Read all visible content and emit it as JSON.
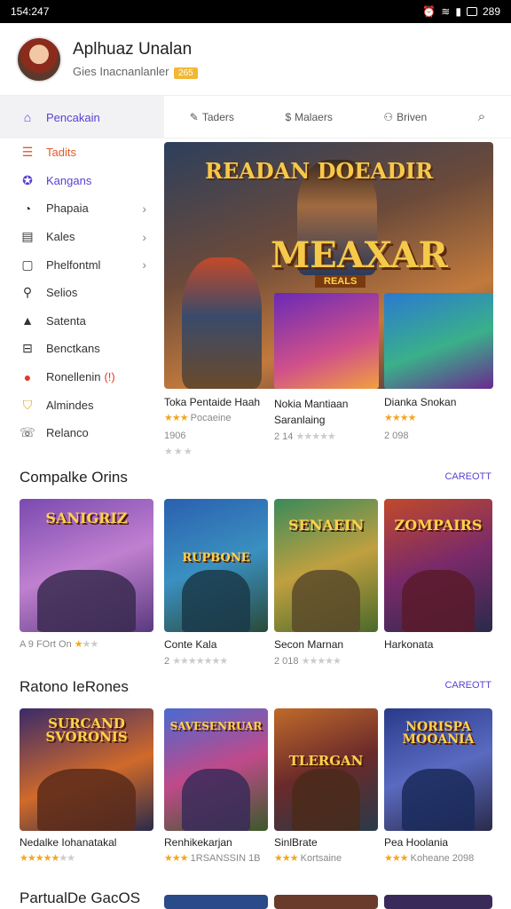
{
  "status": {
    "time": "154:247",
    "battery": "289"
  },
  "header": {
    "title": "Aplhuaz Unalan",
    "subtitle": "Gies Inacnanlanler",
    "badge": "265"
  },
  "sidebar": {
    "items": [
      {
        "label": "Pencakain",
        "icon": "home-icon"
      },
      {
        "label": "Tadits",
        "icon": "list-icon"
      },
      {
        "label": "Kangans",
        "icon": "gamepad-icon"
      },
      {
        "label": "Phapaia",
        "icon": "clock-icon"
      },
      {
        "label": "Kales",
        "icon": "document-icon"
      },
      {
        "label": "Phelfontml",
        "icon": "square-icon"
      },
      {
        "label": "Selios",
        "icon": "wrench-icon"
      },
      {
        "label": "Satenta",
        "icon": "person-icon"
      },
      {
        "label": "Benctkans",
        "icon": "chart-icon"
      },
      {
        "label": "Ronellenin",
        "icon": "record-icon"
      },
      {
        "label": "Almindes",
        "icon": "shield-icon"
      },
      {
        "label": "Relanco",
        "icon": "phone-icon"
      }
    ]
  },
  "topnav": {
    "tab1": "Taders",
    "tab2": "Malaers",
    "tab3": "Briven"
  },
  "hero": {
    "title_top": "READAN DOEADIR",
    "title_main": "MEAXAR",
    "ribbon": "REALS"
  },
  "featured": [
    {
      "title": "Toka Pentaide Haah",
      "meta1": "Pocaeine",
      "meta2": "1906"
    },
    {
      "title": "Nokia Mantiaan Saranlaing",
      "meta1": "2 14",
      "meta2": ""
    },
    {
      "title": "Dianka Snokan",
      "meta1": "",
      "meta2": "2 098"
    }
  ],
  "section1": {
    "title": "Compalke Orins",
    "link": "CAREOTT"
  },
  "row1": [
    {
      "art": "SANIGRIZ",
      "title": "A 9 FOrt On",
      "meta": ""
    },
    {
      "art": "RUPBONE",
      "title": "Conte Kala",
      "meta": "2"
    },
    {
      "art": "SENAEIN",
      "title": "Secon Marnan",
      "meta": "2 018"
    },
    {
      "art": "ZOMPAIRS",
      "title": "Harkonata",
      "meta": ""
    }
  ],
  "section2": {
    "title": "Ratono IeRones",
    "link": "CAREOTT"
  },
  "row2": [
    {
      "art": "SURCAND SVORONIS",
      "title": "Nedalke Iohanatakal",
      "meta": ""
    },
    {
      "art": "SAVESENRUAR",
      "title": "Renhikekarjan",
      "meta": "1RSANSSIN 1B"
    },
    {
      "art": "TLERGAN",
      "title": "SinlBrate",
      "meta": "Kortsaine"
    },
    {
      "art": "NORISPA MOOANIA",
      "title": "Pea Hoolania",
      "meta": "Koheane 2098"
    }
  ],
  "section3": {
    "title": "PartualDe GacOS"
  },
  "colors": {
    "accent": "#5b3fd1",
    "star": "#f3a71f"
  }
}
